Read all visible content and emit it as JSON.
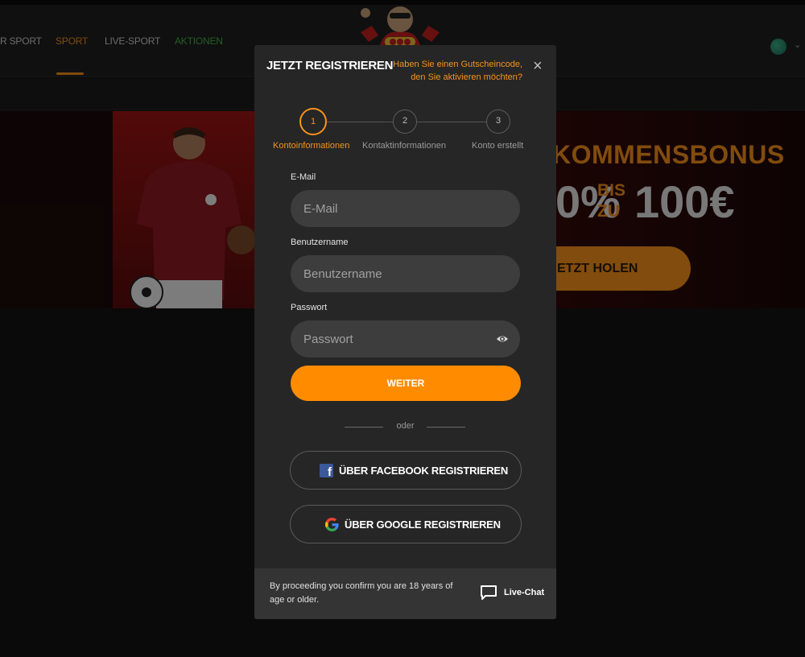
{
  "nav": {
    "items": [
      {
        "label": "R SPORT"
      },
      {
        "label": "SPORT"
      },
      {
        "label": "LIVE-SPORT"
      },
      {
        "label": "AKTIONEN"
      }
    ]
  },
  "banner": {
    "title": "KOMMENSBONUS",
    "percent": "0%",
    "bis": "BIS",
    "zu": "ZU",
    "amount": "100€",
    "button_label": "ETZT HOLEN"
  },
  "modal": {
    "title": "JETZT REGISTRIEREN",
    "voucher_link": "Haben Sie einen Gutscheincode, den Sie aktivieren möchten?",
    "close_glyph": "×",
    "steps": [
      {
        "number": "1",
        "label": "Kontoinformationen",
        "active": true
      },
      {
        "number": "2",
        "label": "Kontaktinformationen",
        "active": false
      },
      {
        "number": "3",
        "label": "Konto erstellt",
        "active": false
      }
    ],
    "fields": {
      "email": {
        "label": "E-Mail",
        "placeholder": "E-Mail",
        "value": ""
      },
      "username": {
        "label": "Benutzername",
        "placeholder": "Benutzername",
        "value": ""
      },
      "password": {
        "label": "Passwort",
        "placeholder": "Passwort",
        "value": ""
      }
    },
    "next_label": "WEITER",
    "or_label": "oder",
    "facebook_label": "ÜBER FACEBOOK REGISTRIEREN",
    "google_label": "ÜBER GOOGLE REGISTRIEREN",
    "footer_text": "By proceeding you confirm you are 18 years of age or older.",
    "live_chat_label": "Live-Chat"
  },
  "colors": {
    "accent": "#ff8c00",
    "modal_bg": "#262626",
    "field_bg": "#3d3d3d",
    "green": "#48b04a"
  },
  "icons": {
    "globe": "globe-icon",
    "chevron": "chevron-down-icon",
    "close": "close-icon",
    "eye": "eye-icon",
    "facebook": "facebook-icon",
    "google": "google-icon",
    "chat": "chat-icon"
  }
}
